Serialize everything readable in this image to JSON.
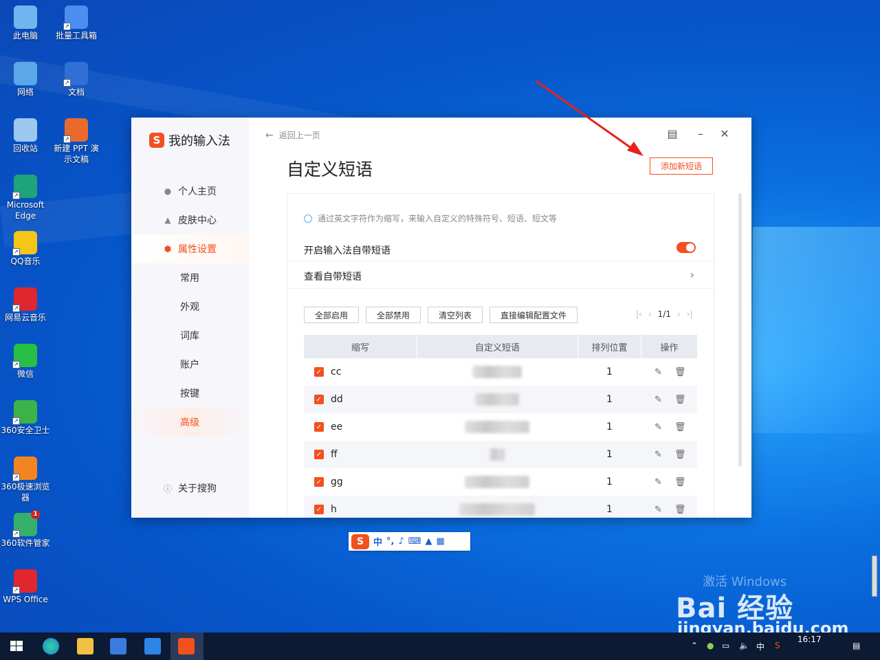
{
  "desktop": {
    "icons": [
      {
        "label": "此电脑",
        "icon": "computer-icon",
        "color": "#6fb6f0"
      },
      {
        "label": "批量工具箱",
        "icon": "toolbox-icon",
        "color": "#4a8ef0"
      },
      {
        "label": "网络",
        "icon": "network-icon",
        "color": "#5aa8e8"
      },
      {
        "label": "文档",
        "icon": "word-doc-icon",
        "color": "#2f6fd6"
      },
      {
        "label": "回收站",
        "icon": "recycle-bin-icon",
        "color": "#9cc8ef"
      },
      {
        "label": "新建 PPT 演示文稿",
        "icon": "ppt-icon",
        "color": "#e86a2c"
      },
      {
        "label": "Microsoft Edge",
        "icon": "edge-icon",
        "color": "#1fa37a"
      },
      {
        "label": "QQ音乐",
        "icon": "qq-music-icon",
        "color": "#f5c518"
      },
      {
        "label": "网易云音乐",
        "icon": "netease-music-icon",
        "color": "#e0262f"
      },
      {
        "label": "微信",
        "icon": "wechat-icon",
        "color": "#27c045"
      },
      {
        "label": "360安全卫士",
        "icon": "360-security-icon",
        "color": "#3cb34a"
      },
      {
        "label": "360极速浏览器",
        "icon": "360-browser-icon",
        "color": "#f2851f"
      },
      {
        "label": "360软件管家",
        "icon": "360-software-icon",
        "color": "#35b06b"
      },
      {
        "label": "WPS Office",
        "icon": "wps-icon",
        "color": "#e0262f"
      }
    ],
    "badge_count": "1"
  },
  "app": {
    "brand_logo": "S",
    "brand_name": "我的输入法",
    "accent": "#f2501f",
    "nav": [
      {
        "label": "个人主页",
        "icon": "user-icon"
      },
      {
        "label": "皮肤中心",
        "icon": "shirt-icon"
      },
      {
        "label": "属性设置",
        "icon": "settings-hex-icon"
      }
    ],
    "subnav": [
      "常用",
      "外观",
      "词库",
      "账户",
      "按键",
      "高级"
    ],
    "about": "关于搜狗",
    "back_label": "返回上一页",
    "page_title": "自定义短语",
    "add_button": "添加新短语",
    "hint": "通过英文字符作为缩写，来输入自定义的特殊符号、短语、短文等",
    "enable_label": "开启输入法自带短语",
    "enable_on": true,
    "view_label": "查看自带短语",
    "toolbar": {
      "enable_all": "全部启用",
      "disable_all": "全部禁用",
      "clear_list": "清空列表",
      "edit_config": "直接编辑配置文件"
    },
    "pager": {
      "page": "1/1"
    },
    "table": {
      "headers": [
        "缩写",
        "自定义短语",
        "排列位置",
        "操作"
      ],
      "rows": [
        {
          "abbr": "cc",
          "position": "1"
        },
        {
          "abbr": "dd",
          "position": "1"
        },
        {
          "abbr": "ee",
          "position": "1"
        },
        {
          "abbr": "ff",
          "position": "1"
        },
        {
          "abbr": "gg",
          "position": "1"
        },
        {
          "abbr": "h",
          "position": "1"
        }
      ]
    }
  },
  "ime_bar": {
    "logo": "S",
    "mode": "中",
    "punct": "°,"
  },
  "watermark": {
    "activate": "激活 Windows",
    "baidu": "Bai 经验",
    "url": "jingyan.baidu.com"
  },
  "taskbar": {
    "ime_mode": "中",
    "time": "16:17"
  }
}
